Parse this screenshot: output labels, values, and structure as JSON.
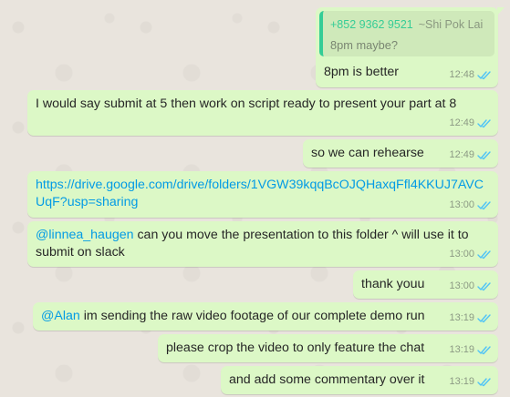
{
  "messages": [
    {
      "id": "m1",
      "quote": {
        "phone": "+852 9362 9521",
        "name": "~Shi Pok Lai",
        "text": "8pm maybe?"
      },
      "text": "8pm is better",
      "time": "12:48"
    },
    {
      "id": "m2",
      "text": "I would say submit at 5 then work on script ready to present your part at 8",
      "time": "12:49"
    },
    {
      "id": "m3",
      "text": "so we can rehearse",
      "time": "12:49"
    },
    {
      "id": "m4",
      "link": "https://drive.google.com/drive/folders/1VGW39kqqBcOJQHaxqFfl4KKUJ7AVCUqF?usp=sharing",
      "time": "13:00"
    },
    {
      "id": "m5",
      "mention": "@linnea_haugen",
      "text": " can you move the presentation to this folder ^ will use it to submit on slack",
      "time": "13:00"
    },
    {
      "id": "m6",
      "text": "thank youu",
      "time": "13:00"
    },
    {
      "id": "m7",
      "mention": "@Alan",
      "text": " im sending the raw video footage of our complete demo run",
      "time": "13:19"
    },
    {
      "id": "m8",
      "text": "please crop the video to only feature the chat",
      "time": "13:19"
    },
    {
      "id": "m9",
      "text": "and add some commentary over it",
      "time": "13:19"
    }
  ],
  "colors": {
    "bubble_outgoing": "#dcf8c6",
    "wallpaper": "#e9e4dd",
    "link": "#039be5",
    "read_ticks": "#4fc3f7",
    "quote_bar": "#35cd96"
  },
  "icons": {
    "read_receipt": "double-check-icon"
  }
}
